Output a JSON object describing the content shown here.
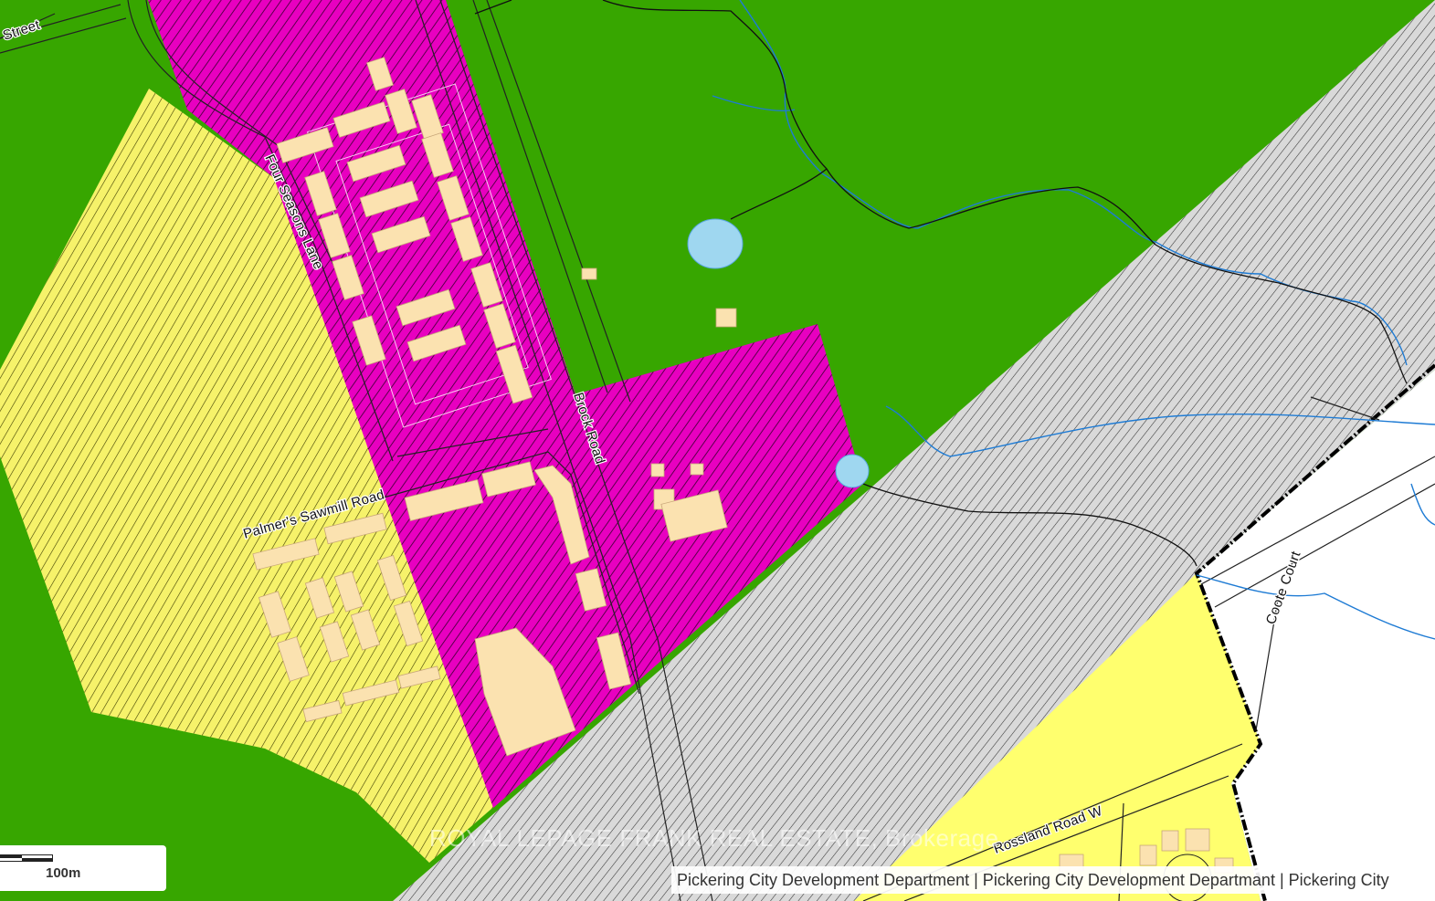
{
  "map": {
    "streets": [
      {
        "id": "street-partial",
        "label": "Street"
      },
      {
        "id": "four-seasons-lane",
        "label": "Four Seasons Lane"
      },
      {
        "id": "brock-road",
        "label": "Brock Road"
      },
      {
        "id": "palmers-sawmill-road",
        "label": "Palmer's Sawmill Road"
      },
      {
        "id": "coote-court",
        "label": "Coote Court"
      },
      {
        "id": "rossland-road-w",
        "label": "Rossland Road W"
      }
    ],
    "zone_colors": {
      "natural_area": "#37a600",
      "commercial_mixed": "#e800c0",
      "residential_hatched": "#f6f26a",
      "residential": "#ffff6e",
      "hydro_corridor": "#d9d9d9",
      "water": "#9fd7f0",
      "buildings": "#fbe2b0",
      "outside_area": "#ffffff"
    }
  },
  "watermark": "ROYAL LEPAGE FRANK REAL ESTATE, Brokerage",
  "scale": {
    "label": "100m"
  },
  "attribution": "Pickering City Development Department | Pickering City Development Departmant | Pickering City"
}
